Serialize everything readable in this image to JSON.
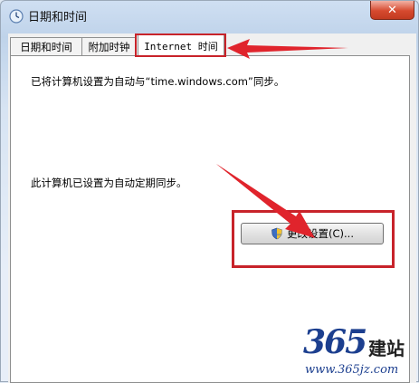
{
  "window": {
    "title": "日期和时间",
    "close_glyph": "✕"
  },
  "tabs": [
    {
      "label": "日期和时间",
      "active": false
    },
    {
      "label": "附加时钟",
      "active": false
    },
    {
      "label": "Internet 时间",
      "active": true
    }
  ],
  "panel": {
    "sync_server_message": "已将计算机设置为自动与“time.windows.com”同步。",
    "auto_sync_message": "此计算机已设置为自动定期同步。",
    "change_settings_label": "更改设置(C)..."
  },
  "watermark": {
    "number": "365",
    "brand": "建站",
    "url": "www.365jz.com"
  },
  "colors": {
    "annotation_red": "#c8232a",
    "watermark_blue": "#1c3f8f"
  },
  "icons": {
    "app": "clock-icon",
    "shield": "uac-shield-icon",
    "close": "close-icon"
  }
}
